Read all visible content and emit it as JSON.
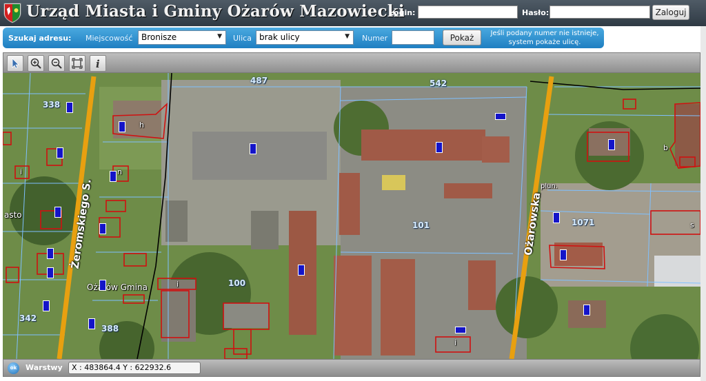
{
  "header": {
    "title": "Urząd Miasta i Gminy Ożarów Mazowiecki",
    "login_label": "Login:",
    "password_label": "Hasło:",
    "login_value": "",
    "password_value": "",
    "login_button": "Zaloguj"
  },
  "search": {
    "title": "Szukaj adresu:",
    "city_label": "Miejscowość",
    "city_value": "Bronisze",
    "street_label": "Ulica",
    "street_value": "brak ulicy",
    "number_label": "Numer",
    "number_value": "",
    "show_button": "Pokaż",
    "hint": "Jeśli podany numer nie istnieje, system pokaże ulicę."
  },
  "toolbar": {
    "tools": [
      "select-pointer",
      "zoom-in",
      "zoom-out",
      "full-extent",
      "info"
    ]
  },
  "map": {
    "parcel_labels": [
      "487",
      "542",
      "338",
      "101",
      "1071",
      "100",
      "342",
      "388"
    ],
    "streets": [
      "Żeromskiego S.",
      "Ożarowska"
    ],
    "places": [
      "asto",
      "Ożarów Gmina"
    ],
    "abbreviations": [
      "plun."
    ],
    "building_marks": [
      "h",
      "n",
      "i",
      "s",
      "b"
    ]
  },
  "statusbar": {
    "badge": "ok",
    "layers_label": "Warstwy",
    "coordinates": "X : 483864.4  Y : 622932.6"
  },
  "colors": {
    "header_bg": "#3a4550",
    "search_bar_bg": "#2a8ad0",
    "road": "#e8a010",
    "parcel_line": "#7fc0ff",
    "building_outline": "#d01010",
    "number_marker": "#1414c8"
  }
}
